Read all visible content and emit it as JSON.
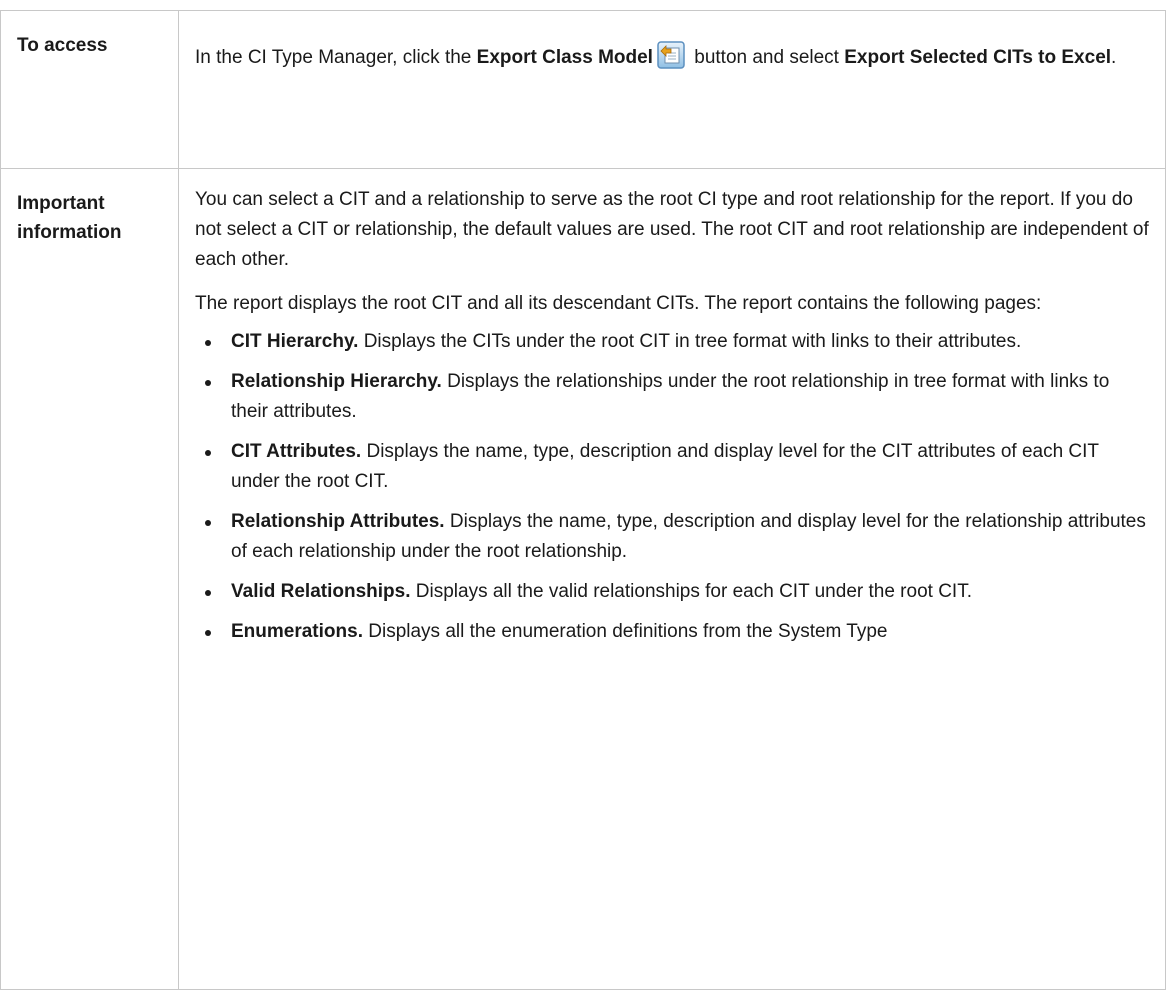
{
  "access": {
    "label": "To access",
    "prefix": "In the CI Type Manager, click the ",
    "button_name": "Export Class Model",
    "middle": " button and select ",
    "menu_item": "Export Selected CITs to Excel",
    "suffix": ".",
    "icon": "export-class-model-icon"
  },
  "info": {
    "label_line1": "Important",
    "label_line2": "information",
    "para1": "You can select a CIT and a relationship to serve as the root CI type and root relationship for the report. If you do not select a CIT or relationship, the default values are used. The root CIT and root relationship are independent of each other.",
    "para2": "The report displays the root CIT and all its descendant CITs. The report contains the following pages:",
    "items": [
      {
        "term": "CIT Hierarchy.",
        "desc": " Displays the CITs under the root CIT in tree format with links to their attributes."
      },
      {
        "term": "Relationship Hierarchy.",
        "desc": " Displays the relationships under the root relationship in tree format with links to their attributes."
      },
      {
        "term": "CIT Attributes.",
        "desc": " Displays the name, type, description and display level for the CIT attributes of each CIT under the root CIT."
      },
      {
        "term": "Relationship Attributes.",
        "desc": " Displays the name, type, description and display level for the relationship attributes of each relationship under the root relationship."
      },
      {
        "term": "Valid Relationships.",
        "desc": " Displays all the valid relationships for each CIT under the root CIT."
      },
      {
        "term": "Enumerations.",
        "desc": " Displays all the enumeration definitions from the System Type"
      }
    ]
  }
}
